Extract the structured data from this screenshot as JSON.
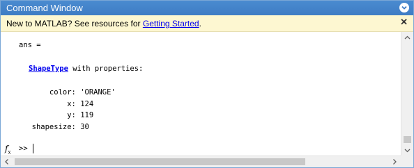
{
  "window": {
    "title": "Command Window"
  },
  "infobar": {
    "message_prefix": "New to MATLAB? See resources for ",
    "link_text": "Getting Started",
    "message_suffix": ".",
    "close_glyph": "✕"
  },
  "output": {
    "ans_line": "ans =",
    "class_name": "ShapeType",
    "class_suffix": " with properties:",
    "properties": [
      {
        "label": "      color: ",
        "value": "'ORANGE'"
      },
      {
        "label": "          x: ",
        "value": "124"
      },
      {
        "label": "          y: ",
        "value": "119"
      },
      {
        "label": "  shapesize: ",
        "value": "30"
      }
    ]
  },
  "command_line": {
    "prompt": ">>",
    "value": "",
    "fx_icon": "fx"
  },
  "icons": {
    "menu": "chevron-down-circle-icon",
    "close": "close-icon",
    "fx": "function-browser-icon",
    "scroll_up": "chevron-up-icon",
    "scroll_down": "chevron-down-icon",
    "scroll_left": "chevron-left-icon",
    "scroll_right": "chevron-right-icon"
  },
  "colors": {
    "titlebar": "#4a8bd0",
    "infobar_bg": "#fdf7d1",
    "link": "#0000ee"
  }
}
